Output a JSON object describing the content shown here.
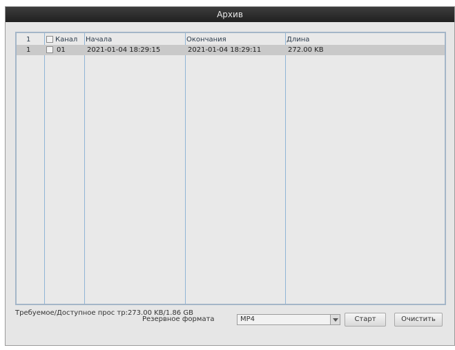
{
  "window": {
    "title": "Архив"
  },
  "table": {
    "headers": {
      "index": "1",
      "channel": "Канал",
      "start": "Начала",
      "end": "Окончания",
      "length": "Длина"
    },
    "rows": [
      {
        "index": "1",
        "channel": "01",
        "start": "2021-01-04 18:29:15",
        "end": "2021-01-04 18:29:11",
        "length": "272.00 KB"
      }
    ]
  },
  "footer": {
    "space_text": "Требуемое/Доступное прос тр:273.00 KB/1.86 GB",
    "format_label": "Резервное формата",
    "format_value": "MP4",
    "start_button": "Старт",
    "clear_button": "Очистить"
  }
}
